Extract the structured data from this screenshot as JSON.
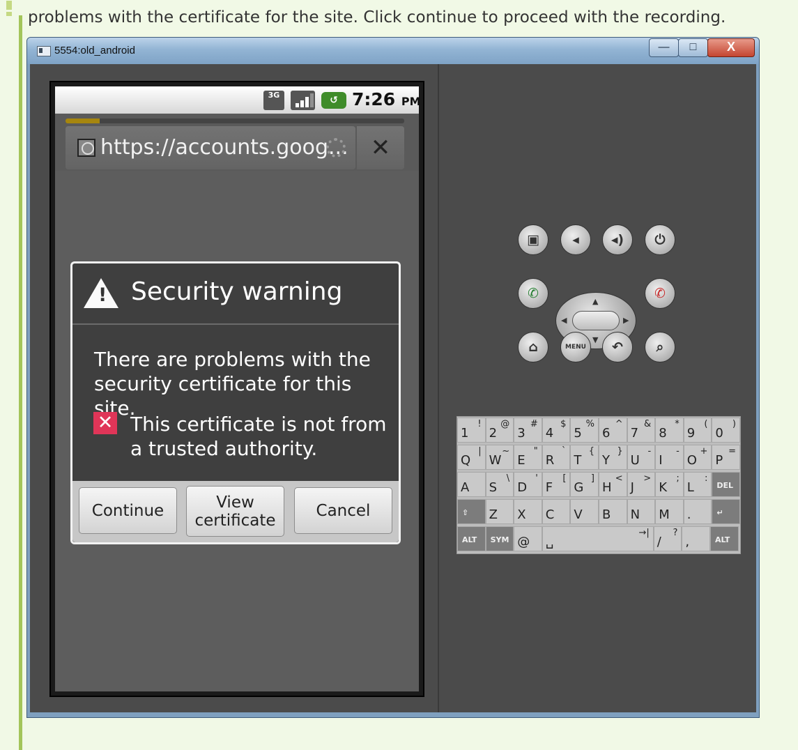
{
  "note": {
    "text": "problems with the certificate for the site. Click continue to proceed with the recording."
  },
  "window": {
    "title": "5554:old_android",
    "minimize": "—",
    "maximize": "□",
    "close": "X"
  },
  "statusbar": {
    "network_label": "3G",
    "battery_label": "↺",
    "time": "7:26",
    "ampm": "PM"
  },
  "browser": {
    "url": "https://accounts.goog...",
    "stop_label": "✕",
    "load_progress": 0.1
  },
  "dialog": {
    "title": "Security warning",
    "message": "There are problems with the security certificate for this site.",
    "reason": "This certificate is not from a trusted authority.",
    "reason_icon": "✕",
    "warn_mark": "!",
    "buttons": {
      "continue": "Continue",
      "view_line1": "View",
      "view_line2": "certificate",
      "cancel": "Cancel"
    }
  },
  "controls": {
    "camera": "▣",
    "vol_down": "◂",
    "vol_up": "◂)",
    "power": "⏻",
    "call": "✆",
    "end_call": "✆",
    "home": "⌂",
    "menu": "MENU",
    "back": "↶",
    "search": "⌕",
    "up": "▲",
    "down": "▼",
    "left": "◀",
    "right": "▶"
  },
  "keyboard": {
    "row1": [
      {
        "m": "1",
        "s": "!"
      },
      {
        "m": "2",
        "s": "@"
      },
      {
        "m": "3",
        "s": "#"
      },
      {
        "m": "4",
        "s": "$"
      },
      {
        "m": "5",
        "s": "%"
      },
      {
        "m": "6",
        "s": "^"
      },
      {
        "m": "7",
        "s": "&"
      },
      {
        "m": "8",
        "s": "*"
      },
      {
        "m": "9",
        "s": "("
      },
      {
        "m": "0",
        "s": ")"
      }
    ],
    "row2": [
      {
        "m": "Q",
        "s": "|"
      },
      {
        "m": "W",
        "s": "~"
      },
      {
        "m": "E",
        "s": "\""
      },
      {
        "m": "R",
        "s": "`"
      },
      {
        "m": "T",
        "s": "{"
      },
      {
        "m": "Y",
        "s": "}"
      },
      {
        "m": "U",
        "s": "-"
      },
      {
        "m": "I",
        "s": "-"
      },
      {
        "m": "O",
        "s": "+"
      },
      {
        "m": "P",
        "s": "="
      }
    ],
    "row3": [
      {
        "m": "A",
        "s": ""
      },
      {
        "m": "S",
        "s": "\\"
      },
      {
        "m": "D",
        "s": "'"
      },
      {
        "m": "F",
        "s": "["
      },
      {
        "m": "G",
        "s": "]"
      },
      {
        "m": "H",
        "s": "<"
      },
      {
        "m": "J",
        "s": ">"
      },
      {
        "m": "K",
        "s": ";"
      },
      {
        "m": "L",
        "s": ":"
      },
      {
        "m": "DEL",
        "s": ""
      }
    ],
    "row4": [
      {
        "m": "⇧",
        "s": ""
      },
      {
        "m": "Z",
        "s": ""
      },
      {
        "m": "X",
        "s": ""
      },
      {
        "m": "C",
        "s": ""
      },
      {
        "m": "V",
        "s": ""
      },
      {
        "m": "B",
        "s": ""
      },
      {
        "m": "N",
        "s": ""
      },
      {
        "m": "M",
        "s": ""
      },
      {
        "m": ".",
        "s": ""
      },
      {
        "m": "↵",
        "s": ""
      }
    ],
    "row5": [
      {
        "m": "ALT",
        "s": ""
      },
      {
        "m": "SYM",
        "s": ""
      },
      {
        "m": "@",
        "s": ""
      },
      {
        "m": "␣",
        "s": "→|"
      },
      {
        "m": "/",
        "s": "?"
      },
      {
        "m": ",",
        "s": ""
      },
      {
        "m": "ALT",
        "s": ""
      }
    ]
  },
  "colors": {
    "note_bg": "#f1f9e6",
    "note_bar": "#a3c55a",
    "emulator_bg": "#4b4b4b",
    "dialog_bg": "#3f3f3f",
    "warning_red": "#e03558",
    "battery_green": "#3f8c2a",
    "progress_gold": "#a6860e"
  }
}
